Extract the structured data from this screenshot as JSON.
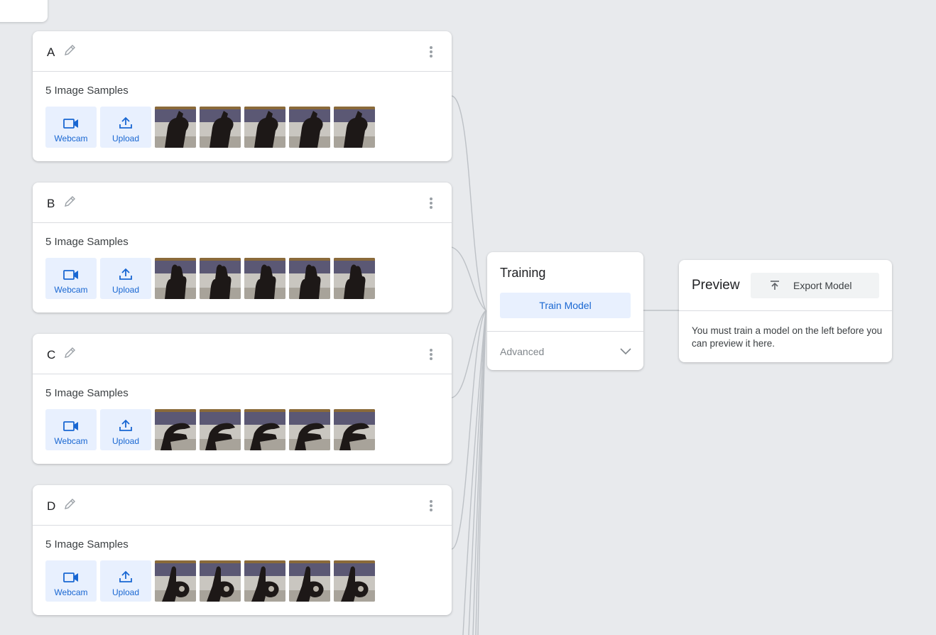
{
  "classes": [
    {
      "name": "A",
      "sample_count": "5 Image Samples",
      "webcam_label": "Webcam",
      "upload_label": "Upload",
      "gesture": "fist"
    },
    {
      "name": "B",
      "sample_count": "5 Image Samples",
      "webcam_label": "Webcam",
      "upload_label": "Upload",
      "gesture": "flat"
    },
    {
      "name": "C",
      "sample_count": "5 Image Samples",
      "webcam_label": "Webcam",
      "upload_label": "Upload",
      "gesture": "curve"
    },
    {
      "name": "D",
      "sample_count": "5 Image Samples",
      "webcam_label": "Webcam",
      "upload_label": "Upload",
      "gesture": "point"
    }
  ],
  "training": {
    "title": "Training",
    "train_button": "Train Model",
    "advanced_label": "Advanced"
  },
  "preview": {
    "title": "Preview",
    "export_button": "Export Model",
    "message": "You must train a model on the left before you can preview it here."
  },
  "colors": {
    "background": "#e8eaed",
    "accent": "#1967d2",
    "accent_light": "#e8f0fe",
    "connector": "#bdc1c6"
  },
  "icons": {
    "edit": "pencil-icon",
    "menu": "more-vert-icon",
    "webcam": "videocam-icon",
    "upload": "upload-icon",
    "expand": "chevron-down-icon",
    "export": "export-icon"
  }
}
